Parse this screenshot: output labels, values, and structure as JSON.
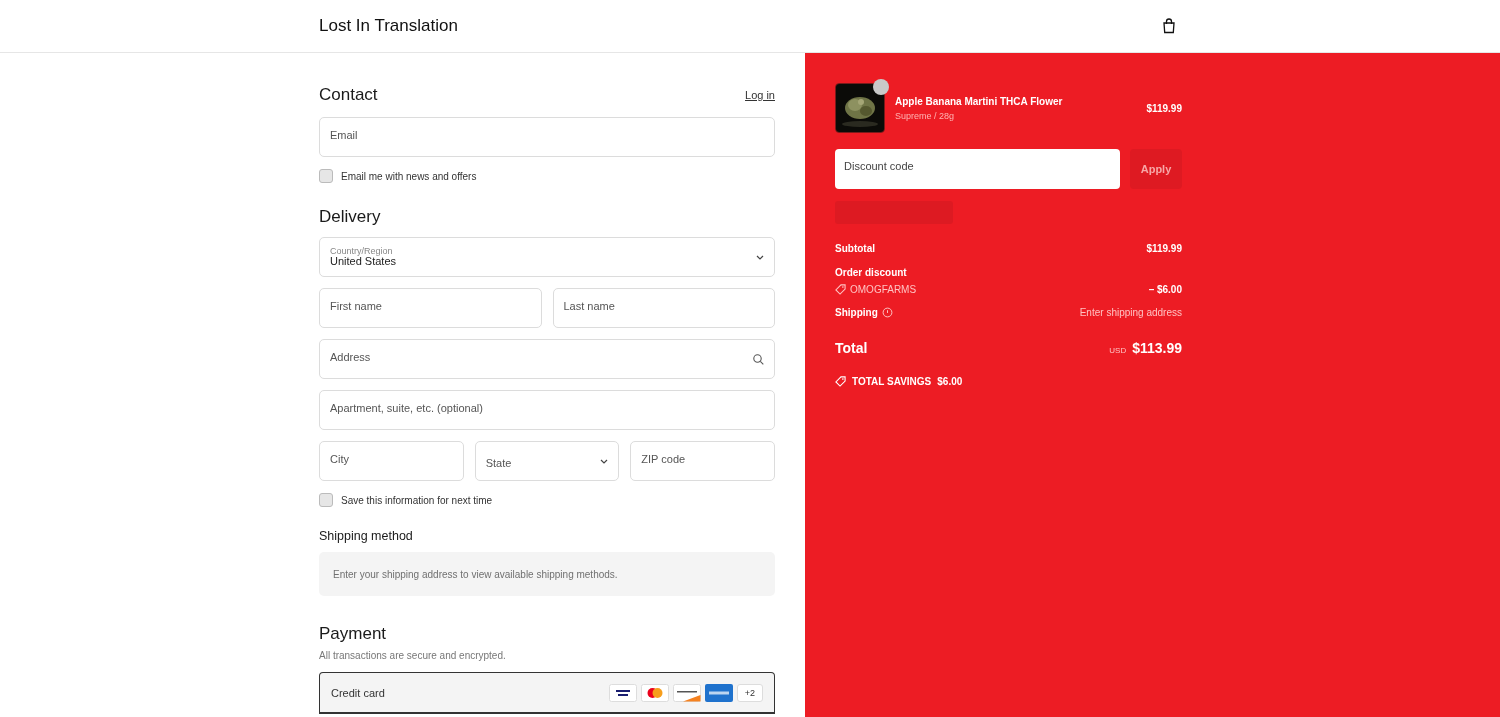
{
  "header": {
    "store_name": "Lost In Translation"
  },
  "contact": {
    "title": "Contact",
    "login_link": "Log in",
    "email": {
      "placeholder": "Email"
    },
    "news_opt_in": {
      "label": "Email me with news and offers",
      "checked": false
    }
  },
  "delivery": {
    "title": "Delivery",
    "country": {
      "label": "Country/Region",
      "value": "United States"
    },
    "first_name": {
      "placeholder": "First name"
    },
    "last_name": {
      "placeholder": "Last name"
    },
    "address": {
      "placeholder": "Address"
    },
    "apartment": {
      "placeholder": "Apartment, suite, etc. (optional)"
    },
    "city": {
      "placeholder": "City"
    },
    "state": {
      "placeholder": "State"
    },
    "zip": {
      "placeholder": "ZIP code"
    },
    "save_info": {
      "label": "Save this information for next time",
      "checked": false
    }
  },
  "shipping_method": {
    "title": "Shipping method",
    "note": "Enter your shipping address to view available shipping methods."
  },
  "payment": {
    "title": "Payment",
    "subtitle": "All transactions are secure and encrypted.",
    "method": "Credit card",
    "more_cards": "+2"
  },
  "order": {
    "item": {
      "name": "Apple Banana Martini THCA Flower",
      "variant": "Supreme / 28g",
      "price": "$119.99"
    },
    "discount": {
      "placeholder": "Discount code",
      "button": "Apply",
      "disabled": true
    },
    "subtotal": {
      "label": "Subtotal",
      "value": "$119.99"
    },
    "order_discount": {
      "label": "Order discount",
      "code": "OMOGFARMS",
      "value": "– $6.00"
    },
    "shipping": {
      "label": "Shipping",
      "value": "Enter shipping address"
    },
    "total": {
      "label": "Total",
      "currency": "USD",
      "value": "$113.99"
    },
    "savings": {
      "label": "TOTAL SAVINGS",
      "value": "$6.00"
    }
  }
}
